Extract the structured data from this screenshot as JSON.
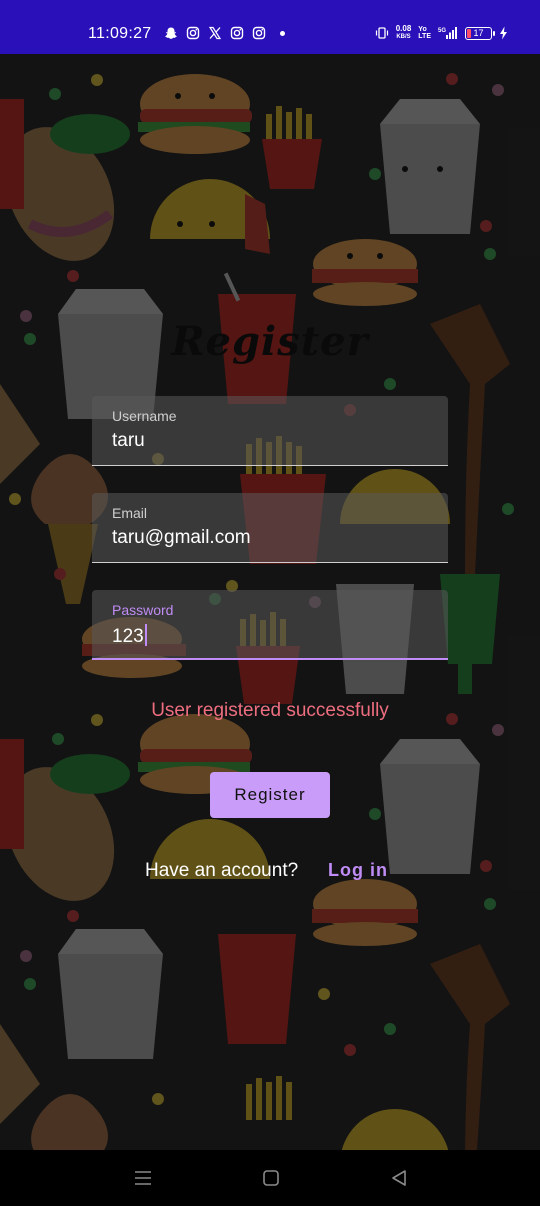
{
  "status_bar": {
    "time": "11:09:27",
    "speed_value": "0.08",
    "speed_unit": "KB/S",
    "volte_top": "Yo",
    "volte_bottom": "LTE",
    "network": "5G",
    "battery": "17",
    "left_icons": [
      "snapchat-icon",
      "instagram-icon",
      "x-icon",
      "instagram-icon",
      "instagram-icon"
    ],
    "accent": "#2a10b8"
  },
  "form": {
    "title": "Register",
    "username": {
      "label": "Username",
      "value": "taru"
    },
    "email": {
      "label": "Email",
      "value": "taru@gmail.com"
    },
    "password": {
      "label": "Password",
      "value": "123"
    },
    "message": "User registered successfully",
    "register_button": "Register",
    "have_account": "Have an account?",
    "login_link": "Log in"
  },
  "colors": {
    "accent": "#c08cf5",
    "button": "#c89cf8",
    "success_message": "#ee6e80"
  },
  "nav": {
    "icons": [
      "recents-icon",
      "home-icon",
      "back-icon"
    ]
  }
}
